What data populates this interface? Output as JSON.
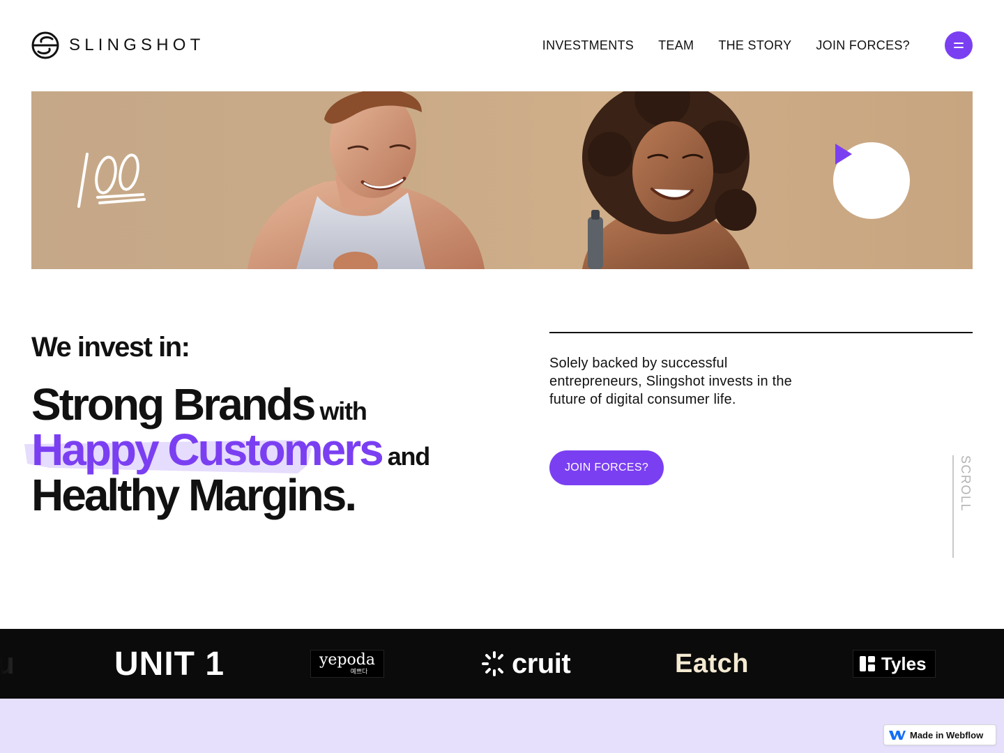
{
  "header": {
    "brand_name": "SLINGSHOT",
    "nav": [
      {
        "label": "INVESTMENTS"
      },
      {
        "label": "TEAM"
      },
      {
        "label": "THE STORY"
      },
      {
        "label": "JOIN FORCES?"
      }
    ],
    "menu_icon": "hamburger-icon"
  },
  "hero": {
    "emoji": "100",
    "play_icon": "play-icon"
  },
  "intro": {
    "label": "We invest in:",
    "headline": {
      "line1_big": "Strong Brands",
      "line1_small": "with",
      "line2_big": "Happy Customers",
      "line2_small": "and",
      "line3_big": "Healthy Margins."
    },
    "description": "Solely backed by successful entrepreneurs, Slingshot invests in the future of digital consumer life.",
    "cta_label": "JOIN FORCES?",
    "scroll_label": "SCROLL"
  },
  "portfolio": {
    "partial": "u",
    "brands": [
      "UNIT 1",
      "yepoda",
      "예쁘다",
      "cruit",
      "Eatch",
      "Tyles"
    ]
  },
  "badge": {
    "label": "Made in Webflow"
  },
  "colors": {
    "accent": "#7b3ff2",
    "band": "#e6e0fd",
    "strip": "#0b0b0b"
  }
}
